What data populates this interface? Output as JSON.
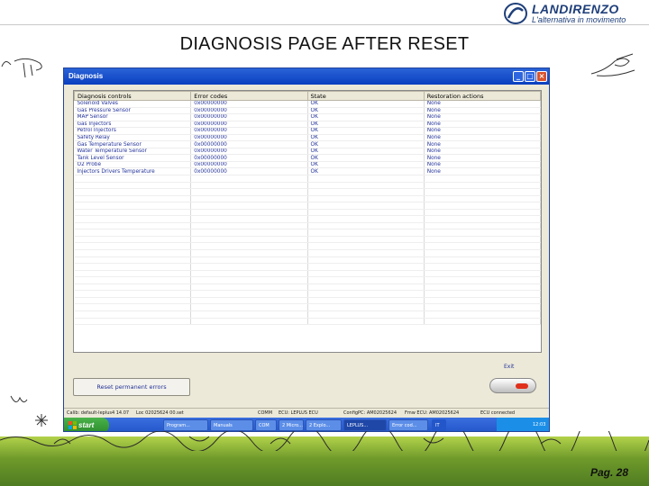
{
  "brand": {
    "name": "LANDIRENZO",
    "tagline": "L'alternativa in movimento"
  },
  "slide": {
    "title": "DIAGNOSIS PAGE AFTER RESET",
    "page": "Pag. 28"
  },
  "window": {
    "title": "Diagnosis",
    "buttons": {
      "minimize": "_",
      "maximize": "□",
      "close": "×"
    }
  },
  "table": {
    "headers": [
      "Diagnosis controls",
      "Error codes",
      "State",
      "Restoration actions"
    ],
    "rows": [
      [
        "Solenoid Valves",
        "0x00000000",
        "OK",
        "None"
      ],
      [
        "Gas Pressure Sensor",
        "0x00000000",
        "OK",
        "None"
      ],
      [
        "MAP Sensor",
        "0x00000000",
        "OK",
        "None"
      ],
      [
        "Gas Injectors",
        "0x00000000",
        "OK",
        "None"
      ],
      [
        "Petrol Injectors",
        "0x00000000",
        "OK",
        "None"
      ],
      [
        "Safety Relay",
        "0x00000000",
        "OK",
        "None"
      ],
      [
        "Gas Temperature Sensor",
        "0x00000000",
        "OK",
        "None"
      ],
      [
        "Water Temperature Sensor",
        "0x00000000",
        "OK",
        "None"
      ],
      [
        "Tank Level Sensor",
        "0x00000000",
        "OK",
        "None"
      ],
      [
        "O2 Probe",
        "0x00000000",
        "OK",
        "None"
      ],
      [
        "Injectors Drivers Temperature",
        "0x00000000",
        "OK",
        "None"
      ]
    ],
    "empty_rows": 22
  },
  "actions": {
    "reset_label": "Reset permanent errors",
    "exit_label": "Exit"
  },
  "statusbar": {
    "calib": "Calib: default-leplus4 14.07",
    "loc": "Loc 02025624 00.set",
    "comm": "COMM",
    "ecu_type": "ECU: LEPLUS ECU",
    "config": "ConfigPC: AM02025624",
    "fw": "Fmw ECU: AM02025624",
    "ecu_status": "ECU connected"
  },
  "taskbar": {
    "start_label": "start",
    "tasks": [
      "Program...",
      "Manuals",
      "COM",
      "2 Micro...",
      "2 Explo...",
      "LEPLUS...",
      "Error cod..."
    ],
    "lang": "IT",
    "clock": "12:03"
  },
  "colors": {
    "titlebar": "#0a3fbf",
    "grid_text": "#23339a",
    "window_bg": "#ece9d8",
    "grass": "#6f9a2a"
  }
}
